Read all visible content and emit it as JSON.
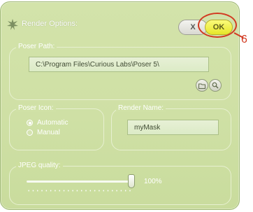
{
  "window": {
    "title": "Render Options:",
    "close_label": "X",
    "ok_label": "OK"
  },
  "annotation": {
    "callout_number": "6",
    "color": "#d23a22"
  },
  "poser_path": {
    "label": "Poser Path:",
    "value": "C:\\Program Files\\Curious Labs\\Poser 5\\",
    "buttons": [
      "folder-icon",
      "search-icon"
    ]
  },
  "poser_icon": {
    "label": "Poser Icon:",
    "options": [
      {
        "label": "Automatic",
        "selected": true
      },
      {
        "label": "Manual",
        "selected": false
      }
    ]
  },
  "render_name": {
    "label": "Render Name:",
    "value": "myMask"
  },
  "jpeg_quality": {
    "label": "JPEG quality:",
    "value_text": "100%",
    "level": 1.0
  },
  "colors": {
    "panel": "#cfe0a5",
    "ok_button": "#e6e62a",
    "label_text": "#ffffff"
  }
}
